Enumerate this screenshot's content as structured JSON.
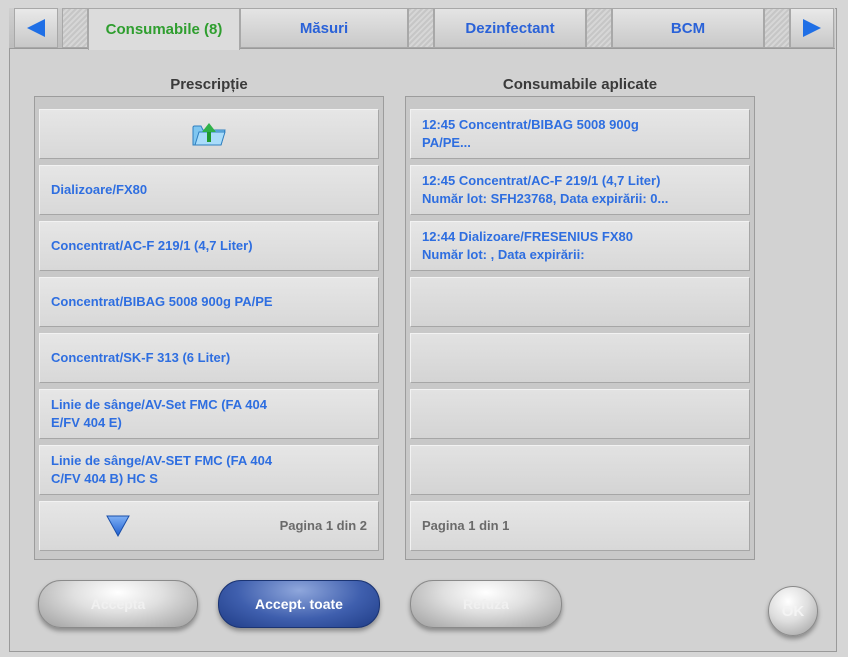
{
  "tabs": [
    {
      "label": "Consumabile (8)",
      "active": true
    },
    {
      "label": "Măsuri",
      "active": false
    },
    {
      "label": "Dezinfectant",
      "active": false
    },
    {
      "label": "BCM",
      "active": false
    }
  ],
  "colors": {
    "tab_active_text": "#2f9e2f",
    "tab_text": "#2a62d8",
    "item_text": "#2e6ee0",
    "arrow_blue": "#1f6fe6",
    "primary_button": "#2f4f9e"
  },
  "left_panel": {
    "title": "Prescripție",
    "folder_icon": "folder-up-icon",
    "items": [
      "Dializoare/FX80",
      "Concentrat/AC-F 219/1 (4,7 Liter)",
      "Concentrat/BIBAG 5008 900g PA/PE",
      "Concentrat/SK-F 313 (6 Liter)",
      "Linie de sânge/AV-Set FMC (FA 404\nE/FV 404 E)",
      "Linie de sânge/AV-SET FMC (FA 404\nC/FV 404 B) HC S"
    ],
    "pager": "Pagina 1 din 2"
  },
  "right_panel": {
    "title": "Consumabile aplicate",
    "items": [
      "12:45 Concentrat/BIBAG 5008 900g\nPA/PE...",
      "12:45 Concentrat/AC-F 219/1 (4,7 Liter)\nNumăr lot: SFH23768, Data expirării: 0...",
      "12:44 Dializoare/FRESENIUS FX80\nNumăr lot: , Data expirării:",
      "",
      "",
      "",
      ""
    ],
    "pager": "Pagina 1 din 1"
  },
  "buttons": {
    "accept": "Accepta",
    "accept_all": "Accept. toate",
    "reject": "Refuza",
    "ok": "OK"
  }
}
